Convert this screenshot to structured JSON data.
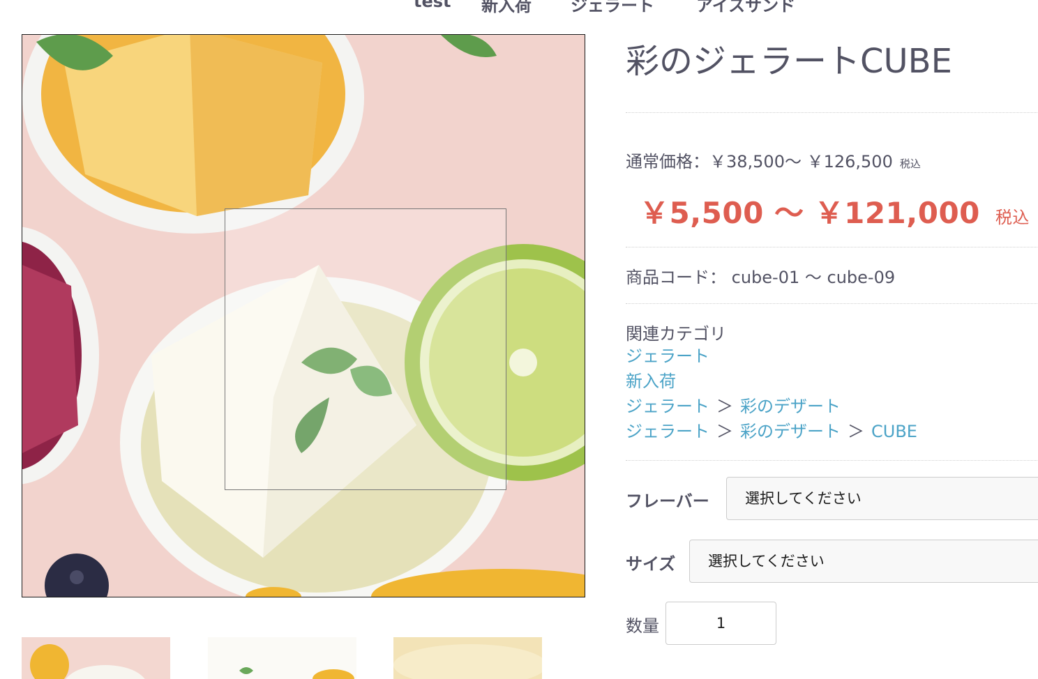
{
  "nav": {
    "items": [
      "test",
      "新入荷",
      "ジェラート",
      "アイスサンド"
    ]
  },
  "product": {
    "title": "彩のジェラートCUBE",
    "regular_price_label": "通常価格：",
    "regular_price": "￥38,500～ ￥126,500",
    "regular_tax": "税込",
    "sale_price": "￥5,500 ～ ￥121,000",
    "sale_tax": "税込",
    "code_label": "商品コード：",
    "code": "cube-01 ～ cube-09",
    "category_title": "関連カテゴリ",
    "categories": [
      [
        "ジェラート"
      ],
      [
        "新入荷"
      ],
      [
        "ジェラート",
        "彩のデザート"
      ],
      [
        "ジェラート",
        "彩のデザート",
        "CUBE"
      ]
    ],
    "category_separator": "＞"
  },
  "form": {
    "flavor_label": "フレーバー",
    "flavor_value": "選択してください",
    "size_label": "サイズ",
    "size_value": "選択してください",
    "quantity_label": "数量",
    "quantity_value": "1"
  },
  "colors": {
    "text": "#525263",
    "sale": "#de5d50",
    "link": "#4ba3c7"
  }
}
